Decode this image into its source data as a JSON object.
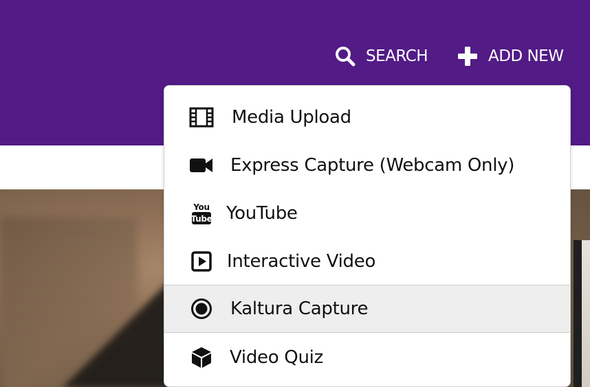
{
  "header": {
    "background_color": "#521b86",
    "search_label": "SEARCH",
    "search_icon": "search-icon",
    "add_new_label": "ADD NEW",
    "add_new_icon": "plus-icon"
  },
  "add_new_menu": {
    "items": [
      {
        "label": "Media Upload",
        "icon": "film-strip-icon"
      },
      {
        "label": "Express Capture (Webcam Only)",
        "icon": "video-camera-icon"
      },
      {
        "label": "YouTube",
        "icon": "youtube-icon"
      },
      {
        "label": "Interactive Video",
        "icon": "play-square-icon"
      },
      {
        "label": "Kaltura Capture",
        "icon": "record-icon",
        "highlighted": true
      },
      {
        "label": "Video Quiz",
        "icon": "cube-icon"
      }
    ]
  }
}
